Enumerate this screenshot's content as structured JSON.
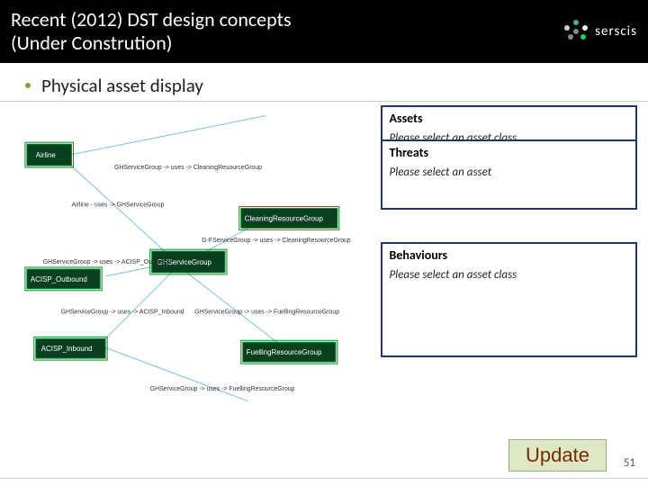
{
  "header": {
    "title_line1": "Recent (2012) DST design concepts",
    "title_line2": "(Under Constrution)",
    "logo_text": "serscis"
  },
  "bullet": {
    "text": "Physical asset display"
  },
  "diagram": {
    "nodes": {
      "airline": "Airline",
      "ghservice": "GHServiceGroup",
      "acisp_out": "ACISP_Outbound",
      "acisp_in": "ACISP_Inbound",
      "cleaning": "CleaningResourceGroup",
      "fuelling": "FuellingResourceGroup"
    },
    "edges": {
      "e1": "GHServiceGroup -> uses -> CleaningResourceGroup",
      "e2": "Airline - uses -> GHServiceGroup",
      "e3": "G-FServiceGroup -> uses -> CleaningResourceGroup",
      "e4": "GHServiceGroup -> uses -> ACISP_Outbound",
      "e5": "GHServiceGroup -> uses -> ACISP_Inbound",
      "e6": "GHServiceGroup -> uses -> FuellingResourceGroup",
      "e7": "GHServiceGroup -> uses -> FuellingResourceGroup"
    }
  },
  "panels": {
    "assets": {
      "title": "Assets",
      "body": "Please select an asset class"
    },
    "threats": {
      "title": "Threats",
      "body": "Please select an asset"
    },
    "behaviours": {
      "title": "Behaviours",
      "body": "Please select an asset class"
    }
  },
  "update_label": "Update",
  "page_number": "51"
}
